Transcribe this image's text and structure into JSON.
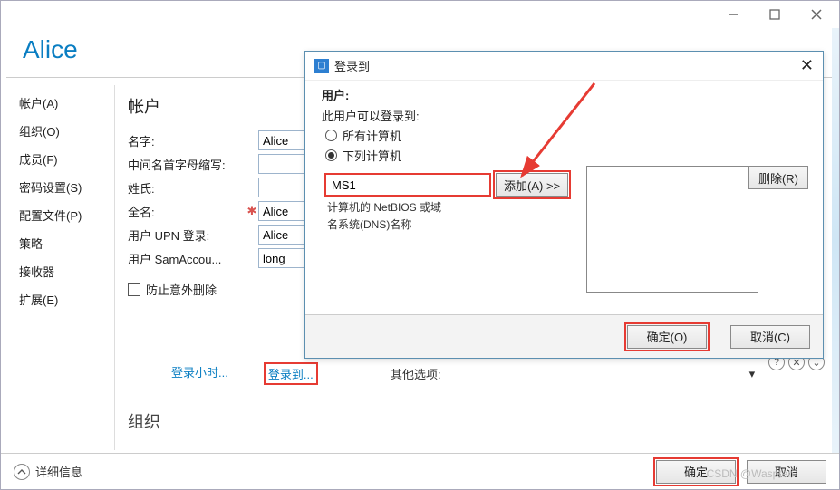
{
  "header": {
    "title": "Alice"
  },
  "titlebar_buttons": [
    "minimize",
    "maximize",
    "close"
  ],
  "sidebar": {
    "items": [
      {
        "label": "帐户(A)"
      },
      {
        "label": "组织(O)"
      },
      {
        "label": "成员(F)"
      },
      {
        "label": "密码设置(S)"
      },
      {
        "label": "配置文件(P)"
      },
      {
        "label": "策略"
      },
      {
        "label": "接收器"
      },
      {
        "label": "扩展(E)"
      }
    ]
  },
  "main": {
    "section_title": "帐户",
    "fields": [
      {
        "label": "名字:",
        "value": "Alice",
        "required": false
      },
      {
        "label": "中间名首字母缩写:",
        "value": "",
        "required": false
      },
      {
        "label": "姓氏:",
        "value": "",
        "required": false
      },
      {
        "label": "全名:",
        "value": "Alice",
        "required": true
      },
      {
        "label": "用户 UPN 登录:",
        "value": "Alice",
        "required": false
      },
      {
        "label": "用户 SamAccou...",
        "value": "long",
        "required": false
      }
    ],
    "prevent_delete_label": "防止意外删除",
    "links": {
      "logon_hours": "登录小时...",
      "logon_to": "登录到..."
    },
    "sub_section": "组织",
    "other_options": "其他选项:"
  },
  "footer": {
    "details": "详细信息",
    "ok": "确定",
    "cancel": "取消"
  },
  "modal": {
    "title": "登录到",
    "user_label": "用户:",
    "hint1": "此用户可以登录到:",
    "radio_all": "所有计算机",
    "radio_list": "下列计算机",
    "computer_value": "MS1",
    "add_btn": "添加(A) >>",
    "hint2a": "计算机的 NetBIOS 或域",
    "hint2b": "名系统(DNS)名称",
    "delete_btn": "删除(R)",
    "ok": "确定(O)",
    "cancel": "取消(C)"
  },
  "watermark": "CSDN @Waspten"
}
